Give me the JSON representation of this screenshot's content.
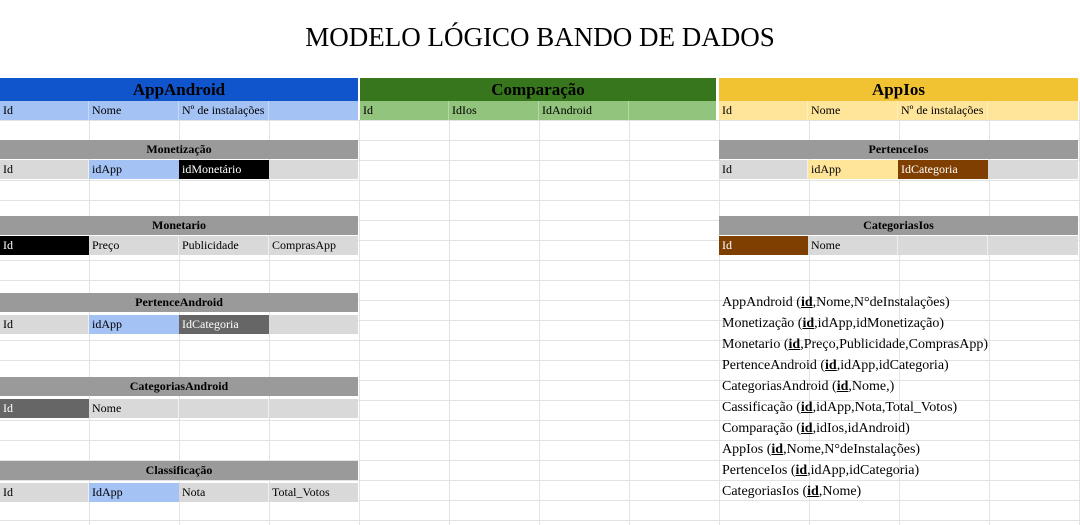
{
  "title": "MODELO LÓGICO BANDO DE DADOS",
  "tables": {
    "appandroid": {
      "header": "AppAndroid",
      "cols": [
        "Id",
        "Nome",
        "Nº de instalações",
        ""
      ]
    },
    "comparacao": {
      "header": "Comparação",
      "cols": [
        "Id",
        "IdIos",
        "IdAndroid",
        ""
      ]
    },
    "appios": {
      "header": "AppIos",
      "cols": [
        "Id",
        "Nome",
        "Nº de instalações",
        ""
      ]
    },
    "monetizacao": {
      "header": "Monetização",
      "cols": [
        "Id",
        "idApp",
        "idMonetário",
        ""
      ]
    },
    "monetario": {
      "header": "Monetario",
      "cols": [
        "Id",
        "Preço",
        "Publicidade",
        "ComprasApp"
      ]
    },
    "pertenceandroid": {
      "header": "PertenceAndroid",
      "cols": [
        "Id",
        "idApp",
        "IdCategoria",
        ""
      ]
    },
    "categoriasandroid": {
      "header": "CategoriasAndroid",
      "cols": [
        "Id",
        "Nome",
        "",
        ""
      ]
    },
    "classificacao": {
      "header": "Classificação",
      "cols": [
        "Id",
        "IdApp",
        "Nota",
        "Total_Votos"
      ]
    },
    "pertenceios": {
      "header": "PertenceIos",
      "cols": [
        "Id",
        "idApp",
        "IdCategoria",
        ""
      ]
    },
    "categoriasios": {
      "header": "CategoriasIos",
      "cols": [
        "Id",
        "Nome",
        "",
        ""
      ]
    }
  },
  "schema": [
    {
      "name": "AppAndroid",
      "key": "id",
      "rest": ",Nome,N°deInstalações)"
    },
    {
      "name": "Monetização",
      "key": "id",
      "rest": ",idApp,idMonetização)"
    },
    {
      "name": "Monetario",
      "key": "id",
      "rest": ",Preço,Publicidade,ComprasApp)"
    },
    {
      "name": "PertenceAndroid",
      "key": "id",
      "rest": ",idApp,idCategoria)"
    },
    {
      "name": "CategoriasAndroid",
      "key": "id",
      "rest": ",Nome,)"
    },
    {
      "name": "Cassificação",
      "key": "id",
      "rest": ",idApp,Nota,Total_Votos)"
    },
    {
      "name": "Comparação",
      "key": "id",
      "rest": ",idIos,idAndroid)"
    },
    {
      "name": "AppIos",
      "key": "id",
      "rest": ",Nome,N°deInstalações)"
    },
    {
      "name": "PertenceIos",
      "key": "id",
      "rest": ",idApp,idCategoria)"
    },
    {
      "name": "CategoriasIos",
      "key": "id",
      "rest": ",Nome)"
    }
  ],
  "colors": {
    "android_blue": "#1155cc",
    "light_blue": "#a4c2f4",
    "green": "#38761d",
    "light_green": "#93c47d",
    "yellow": "#f1c232",
    "light_yellow": "#ffe599",
    "gray": "#9a9a9a",
    "light_gray": "#d9d9d9",
    "dark_gray": "#666666",
    "brown": "#7f3f00",
    "black": "#000000"
  }
}
